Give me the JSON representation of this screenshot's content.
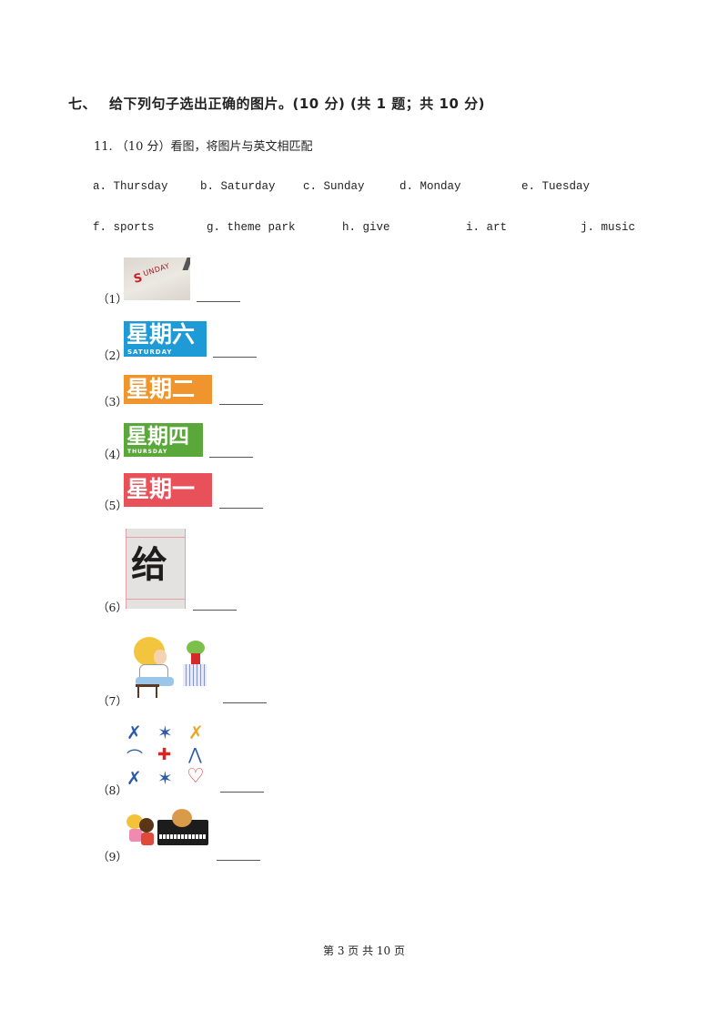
{
  "section": {
    "number": "七、",
    "title": "给下列句子选出正确的图片。(10 分) (共 1 题；共 10 分)"
  },
  "question": {
    "text": "11. （10 分）看图，将图片与英文相匹配"
  },
  "options_row1": [
    {
      "label": "a.",
      "text": "Thursday"
    },
    {
      "label": "b.",
      "text": "Saturday"
    },
    {
      "label": "c.",
      "text": "Sunday"
    },
    {
      "label": "d.",
      "text": "Monday"
    },
    {
      "label": "e.",
      "text": "Tuesday"
    }
  ],
  "options_row2": [
    {
      "label": "f.",
      "text": "sports"
    },
    {
      "label": "g.",
      "text": "theme park"
    },
    {
      "label": "h.",
      "text": "give"
    },
    {
      "label": "i.",
      "text": "art"
    },
    {
      "label": "j.",
      "text": "music"
    }
  ],
  "items": [
    {
      "label": "（1）",
      "image": "sunday-word-photo",
      "image_text": "SUNDAY",
      "answer": ""
    },
    {
      "label": "（2）",
      "image": "saturday-banner",
      "image_text": "星期六",
      "image_subtext": "SATURDAY",
      "color": "#1e9ad6",
      "answer": ""
    },
    {
      "label": "（3）",
      "image": "tuesday-banner",
      "image_text": "星期二",
      "color": "#f0952e",
      "answer": ""
    },
    {
      "label": "（4）",
      "image": "thursday-banner",
      "image_text": "星期四",
      "image_subtext": "THURSDAY",
      "color": "#5aa83a",
      "answer": ""
    },
    {
      "label": "（5）",
      "image": "monday-banner",
      "image_text": "星期一",
      "color": "#e8505a",
      "answer": ""
    },
    {
      "label": "（6）",
      "image": "give-calligraphy",
      "image_text": "给",
      "answer": ""
    },
    {
      "label": "（7）",
      "image": "boy-painting-art",
      "answer": ""
    },
    {
      "label": "（8）",
      "image": "sports-icons",
      "answer": ""
    },
    {
      "label": "（9）",
      "image": "children-piano-music",
      "answer": ""
    }
  ],
  "footer": {
    "text": "第 3 页 共 10 页"
  }
}
